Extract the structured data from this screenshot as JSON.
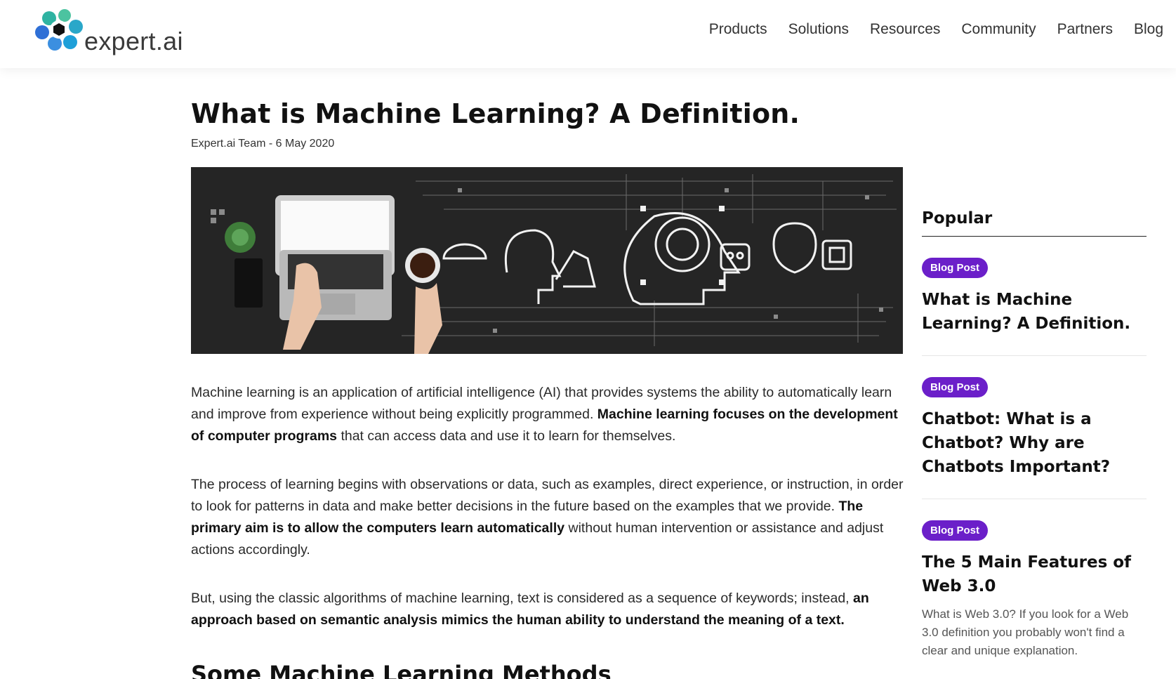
{
  "header": {
    "logo_text": "expert.ai",
    "nav": [
      "Products",
      "Solutions",
      "Resources",
      "Community",
      "Partners",
      "Blog"
    ]
  },
  "article": {
    "title": "What is Machine Learning? A Definition.",
    "byline": "Expert.ai Team - 6 May 2020",
    "hero_image": "laptop-and-ai-icons-banner",
    "paragraphs": [
      {
        "segments": [
          {
            "text": "Machine learning is an application of artificial intelligence (AI) that provides systems the ability to automatically learn and improve from experience without being explicitly programmed. ",
            "bold": false
          },
          {
            "text": "Machine learning focuses on the development of computer programs",
            "bold": true
          },
          {
            "text": " that can access data and use it to learn for themselves.",
            "bold": false
          }
        ]
      },
      {
        "segments": [
          {
            "text": "The process of learning begins with observations or data, such as examples, direct experience, or instruction, in order to look for patterns in data and make better decisions in the future based on the examples that we provide. ",
            "bold": false
          },
          {
            "text": "The primary aim is to allow the computers learn automatically",
            "bold": true
          },
          {
            "text": " without human intervention or assistance and adjust actions accordingly.",
            "bold": false
          }
        ]
      },
      {
        "segments": [
          {
            "text": "But, using the classic algorithms of machine learning, text is considered as a sequence of keywords; instead, ",
            "bold": false
          },
          {
            "text": "an approach based on semantic analysis mimics the human ability to understand the meaning of a text.",
            "bold": true
          }
        ]
      }
    ],
    "subheading": "Some Machine Learning Methods"
  },
  "sidebar": {
    "title": "Popular",
    "cards": [
      {
        "badge": "Blog Post",
        "title": "What is Machine Learning? A Definition.",
        "desc": ""
      },
      {
        "badge": "Blog Post",
        "title": "Chatbot: What is a Chatbot? Why are Chatbots Important?",
        "desc": ""
      },
      {
        "badge": "Blog Post",
        "title": "The 5 Main Features of Web 3.0",
        "desc": "What is Web 3.0? If you look for a Web 3.0 definition you probably won't find a clear and unique explanation."
      }
    ]
  },
  "colors": {
    "badge": "#6b1fc9",
    "logo_teal": "#3bb7a6",
    "logo_blue": "#2f6fd6",
    "logo_green": "#7cc24a"
  }
}
